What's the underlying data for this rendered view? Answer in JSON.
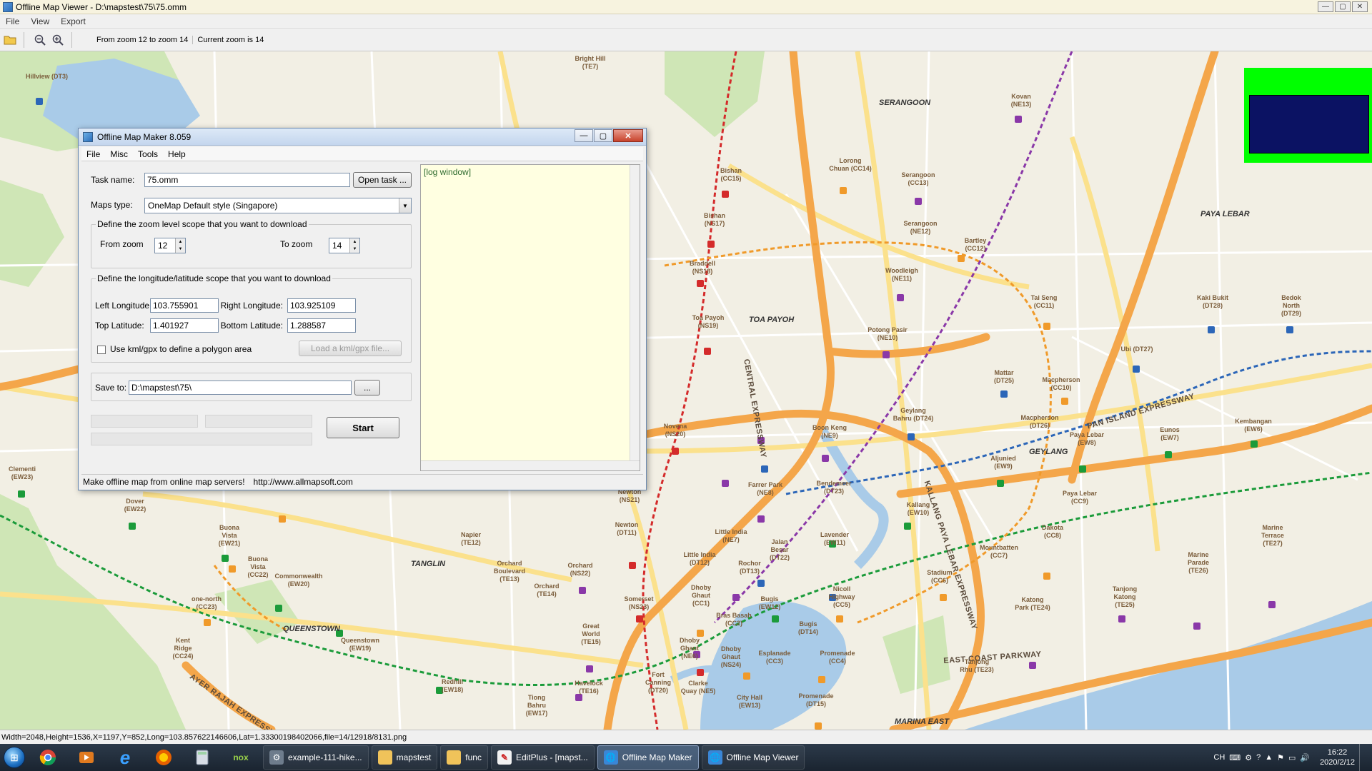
{
  "window": {
    "title": "Offline Map Viewer - D:\\mapstest\\75\\75.omm",
    "controls": [
      "—",
      "▢",
      "✕"
    ]
  },
  "menu": [
    "File",
    "View",
    "Export"
  ],
  "toolbar": {
    "zoom_range": "From zoom 12 to zoom 14",
    "current_zoom": "Current zoom is 14"
  },
  "map": {
    "areas": [
      "SERANGOON",
      "PAYA LEBAR",
      "TOA PAYOH",
      "GEYLANG",
      "TANGLIN",
      "QUEENSTOWN",
      "MARINA EAST"
    ],
    "roads": [
      "CENTRAL EXPRESSWAY",
      "KALLANG PAYA LEBAR EXPRESSWAY",
      "PAN ISLAND EXPRESSWAY",
      "EAST COAST PARKWAY",
      "AYER RAJAH EXPRESSWAY"
    ],
    "stations": [
      {
        "name": "Hillview (DT3)"
      },
      {
        "name": "Bright Hill (TE7)"
      },
      {
        "name": "Kovan (NE13)"
      },
      {
        "name": "Bishan (CC15)"
      },
      {
        "name": "Bishan (NS17)"
      },
      {
        "name": "Lorong Chuan (CC14)"
      },
      {
        "name": "Serangoon (CC13)"
      },
      {
        "name": "Serangoon (NE12)"
      },
      {
        "name": "Bartley (CC12)"
      },
      {
        "name": "Braddell (NS18)"
      },
      {
        "name": "Woodleigh (NE11)"
      },
      {
        "name": "Tai Seng (CC11)"
      },
      {
        "name": "Kaki Bukit (DT28)"
      },
      {
        "name": "Bedok North (DT29)"
      },
      {
        "name": "Toa Payoh (NS19)"
      },
      {
        "name": "Potong Pasir (NE10)"
      },
      {
        "name": "Ubi (DT27)"
      },
      {
        "name": "Mattar (DT25)"
      },
      {
        "name": "Macpherson (CC10)"
      },
      {
        "name": "Macpherson (DT26)"
      },
      {
        "name": "Geylang Bahru (DT24)"
      },
      {
        "name": "Novena (NS20)"
      },
      {
        "name": "Boon Keng (NE9)"
      },
      {
        "name": "Aljunied (EW9)"
      },
      {
        "name": "Paya Lebar (EW8)"
      },
      {
        "name": "Eunos (EW7)"
      },
      {
        "name": "Kembangan (EW6)"
      },
      {
        "name": "Clementi (EW23)"
      },
      {
        "name": "Dover (EW22)"
      },
      {
        "name": "Buona Vista (EW21)"
      },
      {
        "name": "Buona Vista (CC22)"
      },
      {
        "name": "Commonwealth (EW20)"
      },
      {
        "name": "one-north (CC23)"
      },
      {
        "name": "Queenstown (EW19)"
      },
      {
        "name": "Kent Ridge (CC24)"
      },
      {
        "name": "Redhill (EW18)"
      },
      {
        "name": "Tiong Bahru (EW17)"
      },
      {
        "name": "Havelock (TE16)"
      },
      {
        "name": "Great World (TE15)"
      },
      {
        "name": "Orchard (TE14)"
      },
      {
        "name": "Orchard Boulevard (TE13)"
      },
      {
        "name": "Napier (TE12)"
      },
      {
        "name": "Orchard (NS22)"
      },
      {
        "name": "Somerset (NS23)"
      },
      {
        "name": "Newton (NS21)"
      },
      {
        "name": "Newton (DT11)"
      },
      {
        "name": "Farrer Park (NE8)"
      },
      {
        "name": "Bendemeer (DT23)"
      },
      {
        "name": "Little India (NE7)"
      },
      {
        "name": "Little India (DT12)"
      },
      {
        "name": "Jalan Besar (DT22)"
      },
      {
        "name": "Rochor (DT13)"
      },
      {
        "name": "Lavender (EW11)"
      },
      {
        "name": "Kallang (EW10)"
      },
      {
        "name": "Dakota (CC8)"
      },
      {
        "name": "Paya Lebar (CC9)"
      },
      {
        "name": "Mountbatten (CC7)"
      },
      {
        "name": "Stadium (CC6)"
      },
      {
        "name": "Nicoll Highway (CC5)"
      },
      {
        "name": "Bugis (EW12)"
      },
      {
        "name": "Bugis (DT14)"
      },
      {
        "name": "Bras Basah (CC2)"
      },
      {
        "name": "Dhoby Ghaut (CC1)"
      },
      {
        "name": "Dhoby Ghaut (NE6)"
      },
      {
        "name": "Dhoby Ghaut (NS24)"
      },
      {
        "name": "Esplanade (CC3)"
      },
      {
        "name": "Promenade (CC4)"
      },
      {
        "name": "Promenade (DT15)"
      },
      {
        "name": "Fort Canning (DT20)"
      },
      {
        "name": "Clarke Quay (NE5)"
      },
      {
        "name": "City Hall (EW13)"
      },
      {
        "name": "Katong Park (TE24)"
      },
      {
        "name": "Tanjong Katong (TE25)"
      },
      {
        "name": "Marine Parade (TE26)"
      },
      {
        "name": "Marine Terrace (TE27)"
      },
      {
        "name": "Tanjong Rhu (TE23)"
      }
    ]
  },
  "dialog": {
    "title": "Offline Map Maker 8.059",
    "controls": [
      "—",
      "▢",
      "✕"
    ],
    "menu": [
      "File",
      "Misc",
      "Tools",
      "Help"
    ],
    "task_name_label": "Task name:",
    "task_name_value": "75.omm",
    "open_task_label": "Open task ...",
    "maps_type_label": "Maps type:",
    "maps_type_value": "OneMap Default style (Singapore)",
    "zoom_group_label": "Define the zoom level scope that you want to download",
    "from_zoom_label": "From zoom",
    "from_zoom_value": "12",
    "to_zoom_label": "To zoom",
    "to_zoom_value": "14",
    "lonlat_group_label": "Define the longitude/latitude scope that you want to download",
    "left_lon_label": "Left Longitude:",
    "left_lon_value": "103.755901",
    "right_lon_label": "Right Longitude:",
    "right_lon_value": "103.925109",
    "top_lat_label": "Top Latitude:",
    "top_lat_value": "1.401927",
    "bottom_lat_label": "Bottom Latitude:",
    "bottom_lat_value": "1.288587",
    "kml_checkbox_label": "Use kml/gpx to define a polygon area",
    "load_kml_label": "Load a kml/gpx file...",
    "save_to_label": "Save to:",
    "save_to_value": "D:\\mapstest\\75\\",
    "browse_label": "...",
    "start_label": "Start",
    "log_text": "[log window]",
    "status_text": "Make offline map from online map servers!",
    "status_url": "http://www.allmapsoft.com"
  },
  "statusbar": "Width=2048,Height=1536,X=1197,Y=852,Long=103.857622146606,Lat=1.33300198402066,file=14/12918/8131.png",
  "taskbar": {
    "tasks": [
      {
        "label": "example-111-hike...",
        "active": false
      },
      {
        "label": "mapstest",
        "active": false
      },
      {
        "label": "func",
        "active": false
      },
      {
        "label": "EditPlus - [mapst...",
        "active": false
      },
      {
        "label": "Offline Map Maker",
        "active": true
      },
      {
        "label": "Offline Map Viewer",
        "active": false
      }
    ],
    "lang": "CH",
    "time": "16:22",
    "date": "2020/2/12"
  },
  "colors": {
    "expressway": "#f4a64a",
    "major_road": "#fbe18c",
    "minor_road": "#ffffff",
    "park": "#cfe6b6",
    "water": "#a9cbe8",
    "mrt_red": "#d42b2b",
    "mrt_green": "#1b9b3a",
    "mrt_orange": "#f09a2a",
    "mrt_blue": "#2c66b8",
    "mrt_purple": "#8a38a8"
  }
}
